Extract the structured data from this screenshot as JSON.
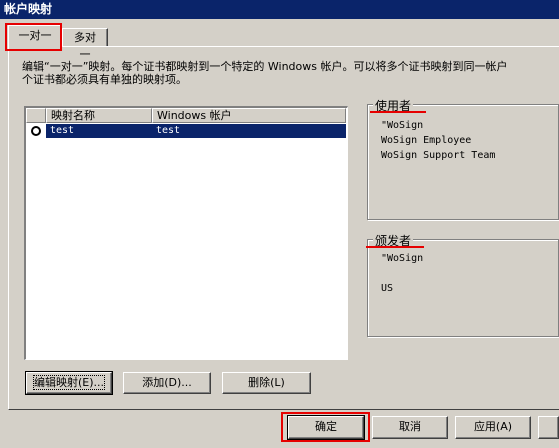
{
  "window": {
    "title": "帐户映射"
  },
  "tabs": [
    {
      "label": "一对一"
    },
    {
      "label": "多对一"
    }
  ],
  "description": {
    "line1": "编辑“一对一”映射。每个证书都映射到一个特定的 Windows 帐户。可以将多个证书映射到同一帐户",
    "line2": "个证书都必须具有单独的映射项。"
  },
  "mapping_list": {
    "columns": [
      "映射名称",
      "Windows 帐户"
    ],
    "rows": [
      {
        "name": "test",
        "account": "test"
      }
    ]
  },
  "subject_group": {
    "label": "使用者",
    "lines": [
      "\"WoSign",
      "WoSign Employee",
      "WoSign Support Team"
    ]
  },
  "issuer_group": {
    "label": "颁发者",
    "lines": [
      "\"WoSign",
      "",
      "US"
    ]
  },
  "list_buttons": {
    "edit": "编辑映射(E)...",
    "add": "添加(D)...",
    "delete": "删除(L)"
  },
  "dialog_buttons": {
    "ok": "确定",
    "cancel": "取消",
    "apply": "应用(A)"
  }
}
